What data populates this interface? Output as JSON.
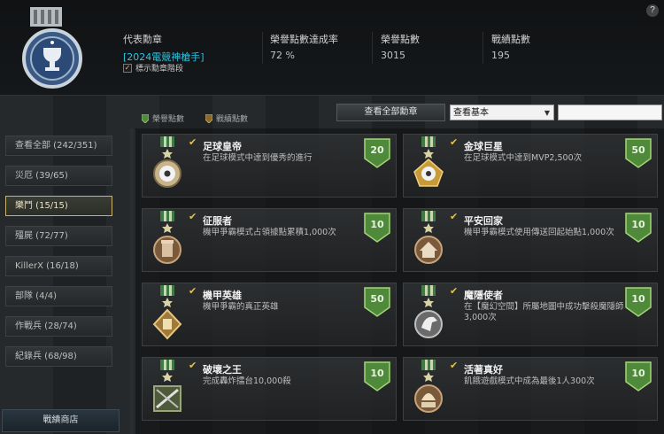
{
  "header": {
    "help_label": "?",
    "rep_medal_label": "代表勳章",
    "rep_medal_value": "[2024電競神槍手]",
    "show_tier_label": "標示勳章階段",
    "show_tier_checked": true,
    "rate_label": "榮譽點數達成率",
    "rate_value": "72 %",
    "honor_label": "榮譽點數",
    "honor_value": "3015",
    "record_label": "戰績點數",
    "record_value": "195"
  },
  "toolbar": {
    "legend_honor": "榮譽點數",
    "legend_record": "戰績點數",
    "view_all": "查看全部勳章",
    "view_select": "查看基本",
    "search_value": ""
  },
  "sidebar": {
    "items": [
      {
        "label": "查看全部 (242/351)",
        "active": false
      },
      {
        "label": "災厄 (39/65)",
        "active": false
      },
      {
        "label": "樂鬥 (15/15)",
        "active": true
      },
      {
        "label": "殭屍 (72/77)",
        "active": false
      },
      {
        "label": "KillerX (16/18)",
        "active": false
      },
      {
        "label": "部隊 (4/4)",
        "active": false
      },
      {
        "label": "作戰兵 (28/74)",
        "active": false
      },
      {
        "label": "紀錄兵 (68/98)",
        "active": false
      }
    ],
    "shop_label": "戰績商店"
  },
  "cards": [
    {
      "name": "足球皇帝",
      "desc": "在足球模式中達到優秀的進行",
      "points": "20",
      "icon": "soccer-ball-icon"
    },
    {
      "name": "金球巨星",
      "desc": "在足球模式中達到MVP2,500次",
      "points": "50",
      "icon": "golden-soccer-ball-icon"
    },
    {
      "name": "征服者",
      "desc": "機甲爭霸模式占領據點累積1,000次",
      "points": "10",
      "icon": "tower-icon"
    },
    {
      "name": "平安回家",
      "desc": "機甲爭霸模式使用傳送回起始點1,000次",
      "points": "10",
      "icon": "home-icon"
    },
    {
      "name": "機甲英雄",
      "desc": "機甲爭霸的真正英雄",
      "points": "50",
      "icon": "mech-hero-icon"
    },
    {
      "name": "魔隱使者",
      "desc": "在【魔幻空間】所屬地圖中成功擊殺魔隱師3,000次",
      "points": "10",
      "icon": "eagle-icon"
    },
    {
      "name": "破壞之王",
      "desc": "完成轟炸擂台10,000殺",
      "points": "10",
      "icon": "crossed-guns-icon"
    },
    {
      "name": "活著真好",
      "desc": "飢餓遊戲模式中成為最後1人300次",
      "points": "10",
      "icon": "survivor-300-icon"
    }
  ],
  "colors": {
    "accent_cyan": "#27c6e6",
    "honor_green": "#4f8a3b",
    "check_gold": "#e5c04a"
  }
}
